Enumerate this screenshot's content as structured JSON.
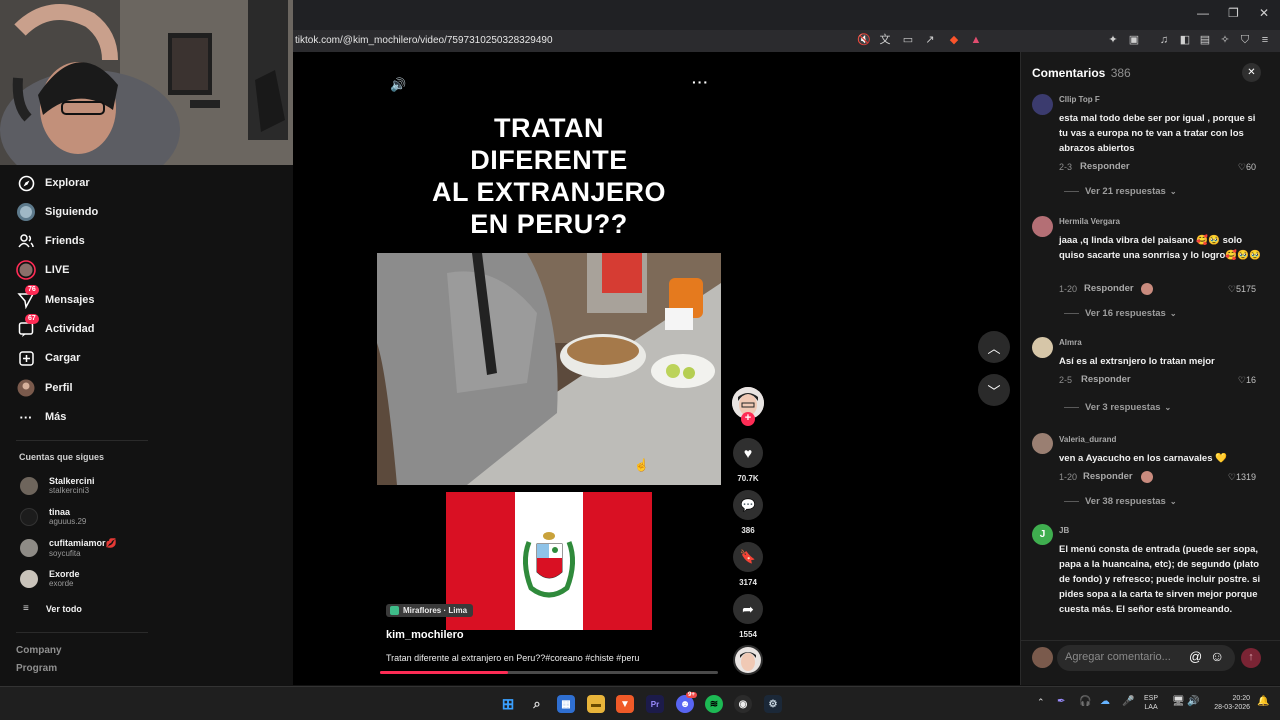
{
  "browser": {
    "url": "tiktok.com/@kim_mochilero/video/7597310250328329490"
  },
  "sidebar": {
    "items": [
      {
        "label": "Explorar",
        "icon": "compass-icon"
      },
      {
        "label": "Siguiendo",
        "icon": "following-avatar-icon"
      },
      {
        "label": "Friends",
        "icon": "friends-icon"
      },
      {
        "label": "LIVE",
        "icon": "live-icon"
      },
      {
        "label": "Mensajes",
        "icon": "messages-icon",
        "badge": "76"
      },
      {
        "label": "Actividad",
        "icon": "activity-icon",
        "badge": "67"
      },
      {
        "label": "Cargar",
        "icon": "upload-icon"
      },
      {
        "label": "Perfil",
        "icon": "profile-icon"
      },
      {
        "label": "Más",
        "icon": "more-icon"
      }
    ],
    "following_title": "Cuentas que sigues",
    "following": [
      {
        "name": "Stalkercini",
        "handle": "stalkercini3"
      },
      {
        "name": "tinaa",
        "handle": "aguuus.29"
      },
      {
        "name": "cufitamiamor💋",
        "handle": "soycufita"
      },
      {
        "name": "Exorde",
        "handle": "exorde"
      }
    ],
    "see_all": "Ver todo",
    "footer": [
      "Company",
      "Program"
    ]
  },
  "video": {
    "headline": [
      "TRATAN",
      "DIFERENTE",
      "AL EXTRANJERO",
      "EN PERU??"
    ],
    "location": "Miraflores · Lima",
    "author": "kim_mochilero",
    "caption": "Tratan diferente al extranjero en Peru??#coreano #chiste #peru",
    "progress": 0.38,
    "likes": "70.7K",
    "comments": "386",
    "saves": "3174",
    "shares": "1554"
  },
  "comments_panel": {
    "title": "Comentarios",
    "count": "386",
    "reply_label": "Responder",
    "input_placeholder": "Agregar comentario...",
    "items": [
      {
        "user": "Cllip Top F",
        "text": "esta mal todo debe ser por igual , porque si tu vas a europa no te van a tratar con los abrazos abiertos",
        "date": "2-3",
        "likes": "60",
        "more": "Ver 21 respuestas"
      },
      {
        "user": "Hermila Vergara",
        "text": "jaaa ,q linda vibra del paisano 🥰🥹 solo quiso sacarte una sonrrisa y lo logro🥰🥹🥹",
        "date": "1-20",
        "likes": "5175",
        "more": "Ver 16 respuestas"
      },
      {
        "user": "Almra",
        "text": "Así es al extrsnjero lo tratan mejor",
        "date": "2-5",
        "likes": "16",
        "more": "Ver 3 respuestas"
      },
      {
        "user": "Valeria_durand",
        "text": "ven a Ayacucho en los carnavales 💛",
        "date": "1-20",
        "likes": "1319",
        "more": "Ver 38 respuestas"
      },
      {
        "user": "JB",
        "text": "El menú consta de entrada (puede ser sopa, papa a la huancaina, etc); de segundo (plato de fondo) y refresco; puede incluir postre. si pides sopa a la carta te sirven mejor porque cuesta más. El señor está bromeando."
      }
    ]
  },
  "taskbar": {
    "lang": "ESP",
    "layout": "LAA",
    "time": "20:20",
    "date": "28-03-2026",
    "discord_badge": "9+"
  },
  "colors": {
    "accent": "#fe2c55",
    "peru_red": "#d91023",
    "panel": "#181818"
  }
}
